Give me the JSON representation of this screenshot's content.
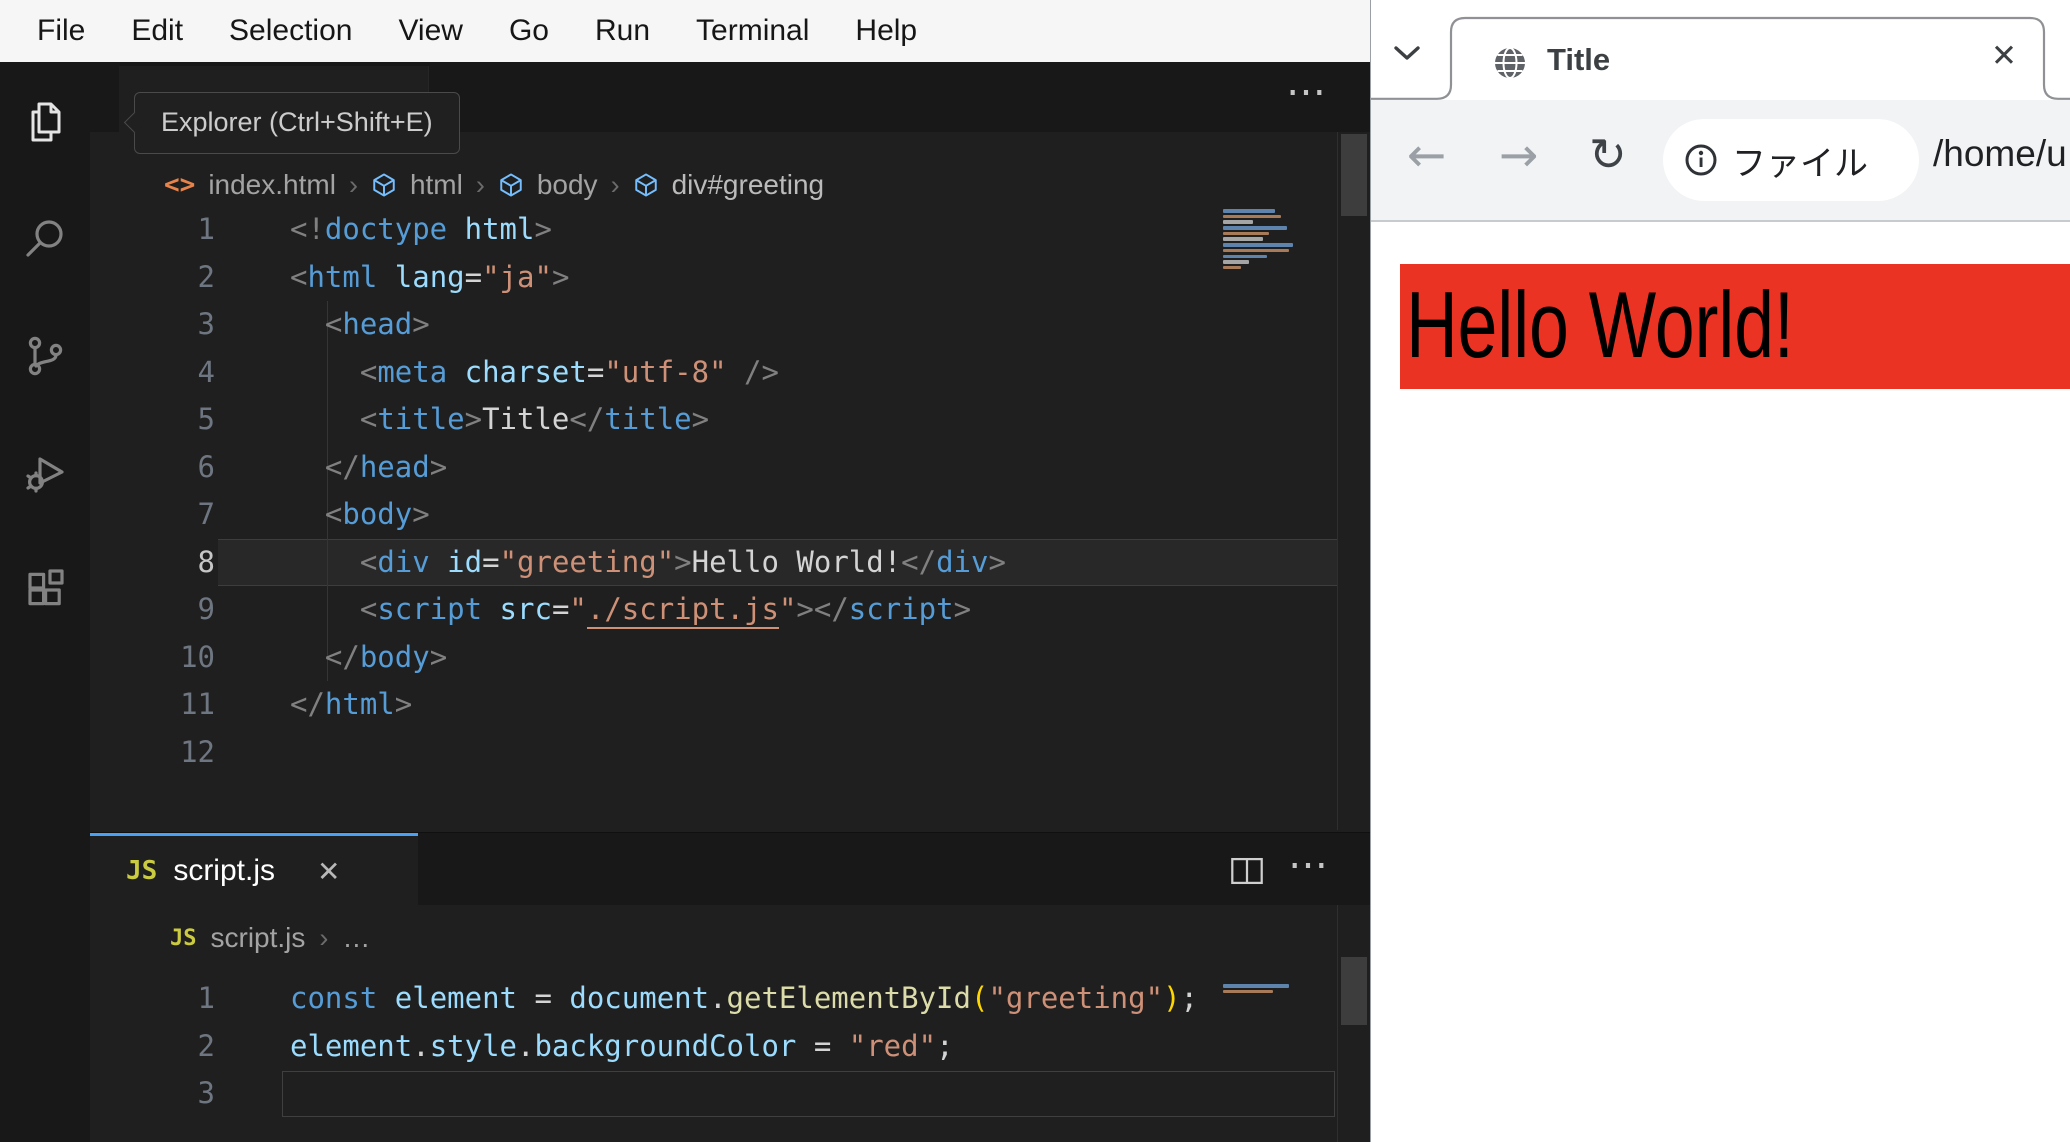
{
  "menubar": {
    "items": [
      "File",
      "Edit",
      "Selection",
      "View",
      "Go",
      "Run",
      "Terminal",
      "Help"
    ]
  },
  "activity_bar": {
    "tooltip": "Explorer (Ctrl+Shift+E)",
    "icons": [
      "explorer",
      "search",
      "source-control",
      "run-and-debug",
      "extensions"
    ]
  },
  "editor_top": {
    "more_label": "⋯",
    "breadcrumb": {
      "file_icon": "<>",
      "file": "index.html",
      "sep": "›",
      "items": [
        "html",
        "body",
        "div#greeting"
      ]
    },
    "lines": [
      {
        "num": "1",
        "seg": [
          [
            "p",
            "<!"
          ],
          [
            "t",
            "doctype"
          ],
          [
            "x",
            " "
          ],
          [
            "a",
            "html"
          ],
          [
            "p",
            ">"
          ]
        ]
      },
      {
        "num": "2",
        "seg": [
          [
            "p",
            "<"
          ],
          [
            "t",
            "html"
          ],
          [
            "x",
            " "
          ],
          [
            "a",
            "lang"
          ],
          [
            "x",
            "="
          ],
          [
            "s",
            "\"ja\""
          ],
          [
            "p",
            ">"
          ]
        ]
      },
      {
        "num": "3",
        "seg": [
          [
            "p",
            "  <"
          ],
          [
            "t",
            "head"
          ],
          [
            "p",
            ">"
          ]
        ]
      },
      {
        "num": "4",
        "seg": [
          [
            "p",
            "    <"
          ],
          [
            "t",
            "meta"
          ],
          [
            "x",
            " "
          ],
          [
            "a",
            "charset"
          ],
          [
            "x",
            "="
          ],
          [
            "s",
            "\"utf-8\""
          ],
          [
            "x",
            " "
          ],
          [
            "p",
            "/>"
          ]
        ]
      },
      {
        "num": "5",
        "seg": [
          [
            "p",
            "    <"
          ],
          [
            "t",
            "title"
          ],
          [
            "p",
            ">"
          ],
          [
            "x",
            "Title"
          ],
          [
            "p",
            "</"
          ],
          [
            "t",
            "title"
          ],
          [
            "p",
            ">"
          ]
        ]
      },
      {
        "num": "6",
        "seg": [
          [
            "p",
            "  </"
          ],
          [
            "t",
            "head"
          ],
          [
            "p",
            ">"
          ]
        ]
      },
      {
        "num": "7",
        "seg": [
          [
            "p",
            "  <"
          ],
          [
            "t",
            "body"
          ],
          [
            "p",
            ">"
          ]
        ]
      },
      {
        "num": "8",
        "cur": "hl",
        "seg": [
          [
            "p",
            "    <"
          ],
          [
            "t",
            "div"
          ],
          [
            "x",
            " "
          ],
          [
            "a",
            "id"
          ],
          [
            "x",
            "="
          ],
          [
            "s",
            "\"greeting\""
          ],
          [
            "p",
            ">"
          ],
          [
            "x",
            "Hello World!"
          ],
          [
            "p",
            "</"
          ],
          [
            "t",
            "div"
          ],
          [
            "p",
            ">"
          ]
        ]
      },
      {
        "num": "9",
        "seg": [
          [
            "p",
            "    <"
          ],
          [
            "t",
            "script"
          ],
          [
            "x",
            " "
          ],
          [
            "a",
            "src"
          ],
          [
            "x",
            "="
          ],
          [
            "s",
            "\""
          ],
          [
            "u",
            "./script.js"
          ],
          [
            "s",
            "\""
          ],
          [
            "p",
            "></"
          ],
          [
            "t",
            "script"
          ],
          [
            "p",
            ">"
          ]
        ]
      },
      {
        "num": "10",
        "seg": [
          [
            "p",
            "  </"
          ],
          [
            "t",
            "body"
          ],
          [
            "p",
            ">"
          ]
        ]
      },
      {
        "num": "11",
        "seg": [
          [
            "p",
            "</"
          ],
          [
            "t",
            "html"
          ],
          [
            "p",
            ">"
          ]
        ]
      },
      {
        "num": "12",
        "seg": []
      }
    ]
  },
  "editor_bottom": {
    "more_label": "⋯",
    "tab": {
      "icon": "JS",
      "label": "script.js",
      "close": "✕"
    },
    "breadcrumb": {
      "icon": "JS",
      "file": "script.js",
      "sep": "›",
      "more": "…"
    },
    "lines": [
      {
        "num": "1",
        "seg": [
          [
            "t",
            "const"
          ],
          [
            "x",
            " "
          ],
          [
            "a",
            "element"
          ],
          [
            "x",
            " = "
          ],
          [
            "a",
            "document"
          ],
          [
            "x",
            "."
          ],
          [
            "f",
            "getElementById"
          ],
          [
            "g",
            "("
          ],
          [
            "s",
            "\"greeting\""
          ],
          [
            "g",
            ")"
          ],
          [
            "x",
            ";"
          ]
        ]
      },
      {
        "num": "2",
        "seg": [
          [
            "a",
            "element"
          ],
          [
            "x",
            "."
          ],
          [
            "a",
            "style"
          ],
          [
            "x",
            "."
          ],
          [
            "a",
            "backgroundColor"
          ],
          [
            "x",
            " = "
          ],
          [
            "s",
            "\"red\""
          ],
          [
            "x",
            ";"
          ]
        ]
      },
      {
        "num": "3",
        "cur": "box",
        "seg": []
      }
    ]
  },
  "browser": {
    "tab": {
      "title": "Title",
      "close": "✕"
    },
    "toolbar": {
      "back": "←",
      "forward": "→",
      "reload": "↻",
      "chip": "ファイル",
      "url": "/home/u"
    },
    "page": {
      "text": "Hello World!",
      "bg": "#ea3323"
    }
  },
  "colors": {
    "tab_accent": "#4aa0f5",
    "page_red": "#ea3323"
  }
}
